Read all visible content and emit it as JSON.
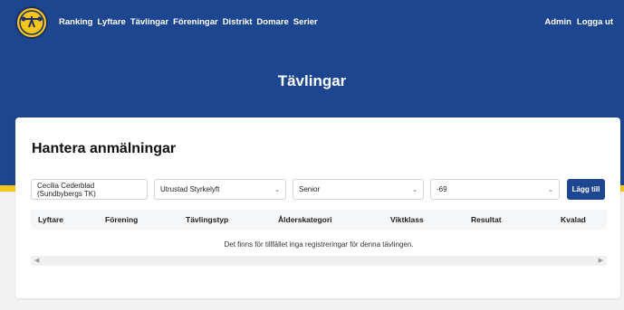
{
  "nav": {
    "items": [
      "Ranking",
      "Lyftare",
      "Tävlingar",
      "Föreningar",
      "Distrikt",
      "Domare",
      "Serier"
    ],
    "right": [
      "Admin",
      "Logga ut"
    ]
  },
  "page": {
    "title": "Tävlingar"
  },
  "card": {
    "title": "Hantera anmälningar",
    "form": {
      "lifter_value": "Cecilia Cederblad (Sundbybergs TK)",
      "equipment_value": "Utrustad Styrkelyft",
      "age_value": "Senior",
      "weight_value": "-69",
      "add_label": "Lägg till"
    },
    "table": {
      "headers": [
        "Lyftare",
        "Förening",
        "Tävlingstyp",
        "Ålderskategori",
        "Viktklass",
        "Resultat",
        "Kvalad"
      ],
      "empty_message": "Det finns för tillfället inga registreringar för denna tävlingen."
    }
  },
  "colors": {
    "brand_blue": "#1d4690",
    "brand_yellow": "#f2c61a"
  },
  "icons": {
    "logo": "federation-logo-icon",
    "dropdown": "chevron-down-icon",
    "scroll_left": "arrow-left-icon",
    "scroll_right": "arrow-right-icon"
  }
}
